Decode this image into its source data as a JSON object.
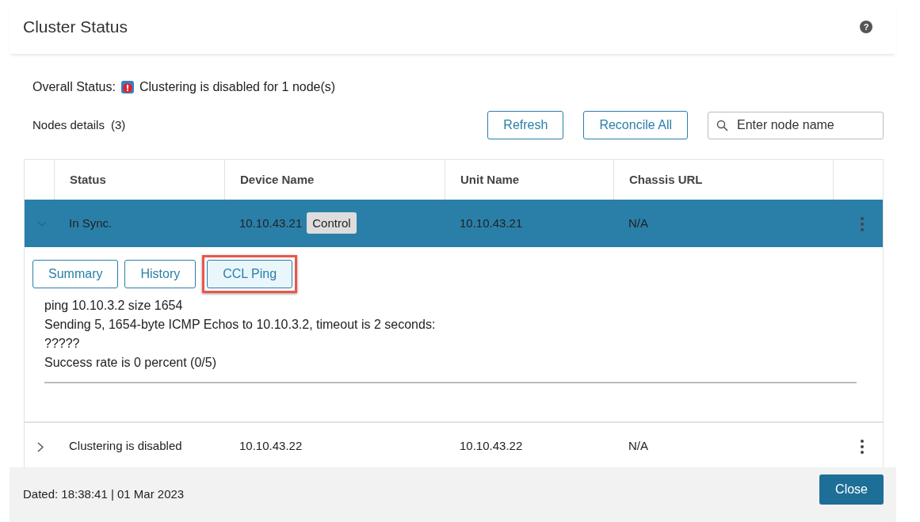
{
  "window": {
    "title": "Cluster Status",
    "help_icon": "?"
  },
  "overall_status": {
    "label": "Overall Status:",
    "text": "Clustering is disabled for 1 node(s)"
  },
  "nodes_details": {
    "label": "Nodes details",
    "count": "(3)"
  },
  "toolbar": {
    "buttons": [
      "Refresh",
      "Reconcile All"
    ],
    "search": {
      "placeholder": "Enter node name"
    }
  },
  "table": {
    "columns": [
      "Status",
      "Device Name",
      "Unit Name",
      "Chassis URL"
    ],
    "rows": [
      {
        "status": "In Sync.",
        "device_name": "10.10.43.21",
        "role_badge": "Control",
        "unit_name": "10.10.43.21",
        "chassis_url": "N/A",
        "expanded": true,
        "selected": true,
        "detail": {
          "tabs": [
            {
              "label": "Summary",
              "selected": false,
              "highlighted": false
            },
            {
              "label": "History",
              "selected": false,
              "highlighted": false
            },
            {
              "label": "CCL Ping",
              "selected": true,
              "highlighted": true
            }
          ],
          "output_lines": [
            "ping 10.10.3.2 size 1654",
            "Sending 5, 1654-byte ICMP Echos to 10.10.3.2, timeout is 2 seconds:",
            "?????",
            "Success rate is 0 percent (0/5)"
          ]
        }
      },
      {
        "status": "Clustering is disabled",
        "device_name": "10.10.43.22",
        "unit_name": "10.10.43.22",
        "chassis_url": "N/A",
        "expanded": false,
        "selected": false
      }
    ]
  },
  "footer": {
    "dated": "Dated: 18:38:41 | 01 Mar 2023",
    "close_button": "Close"
  }
}
